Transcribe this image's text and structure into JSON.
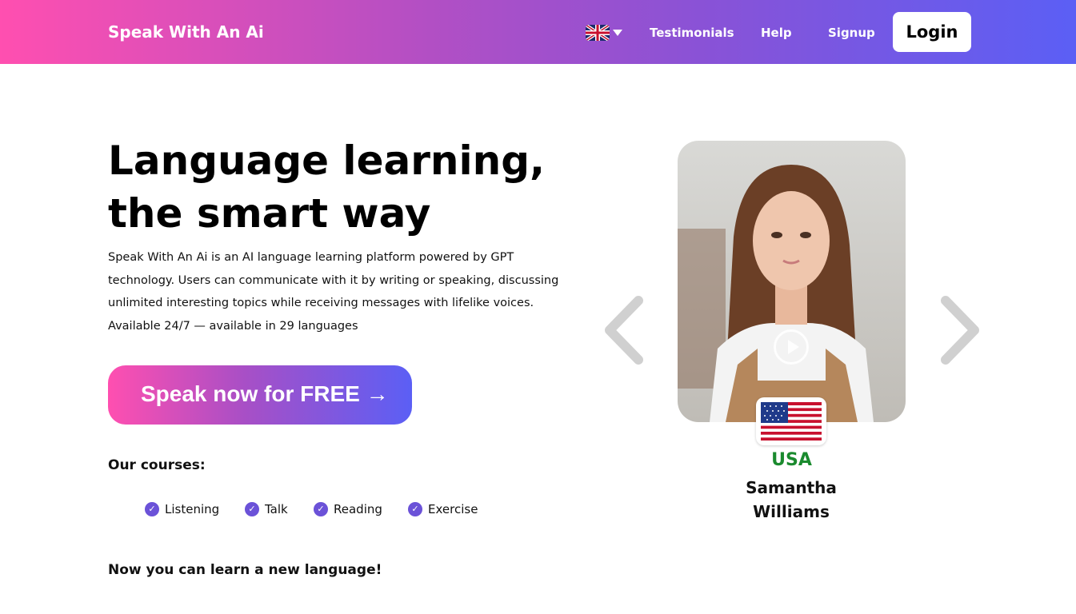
{
  "nav": {
    "brand": "Speak With An Ai",
    "language_icon": "uk-flag-icon",
    "links": [
      "Testimonials",
      "Help",
      "Signup"
    ],
    "login": "Login"
  },
  "hero": {
    "title_line1": "Language learning,",
    "title_line2": "the smart way",
    "description": "Speak With An Ai is an AI language learning platform powered by GPT technology. Users can communicate with it by writing or speaking, discussing unlimited interesting topics while receiving messages with lifelike voices. Available 24/7 — available in 29 languages",
    "cta": "Speak now for FREE →"
  },
  "courses": {
    "heading": "Our courses:",
    "items": [
      "Listening",
      "Talk",
      "Reading",
      "Exercise"
    ]
  },
  "tagline": "Now you can learn a new language!",
  "carousel": {
    "country": "USA",
    "name": "Samantha Williams",
    "flag_icon": "us-flag-icon"
  },
  "colors": {
    "gradient_start": "#ff4fb0",
    "gradient_end": "#5b5ff5",
    "check": "#6b52d8",
    "country": "#1a8a2e"
  }
}
